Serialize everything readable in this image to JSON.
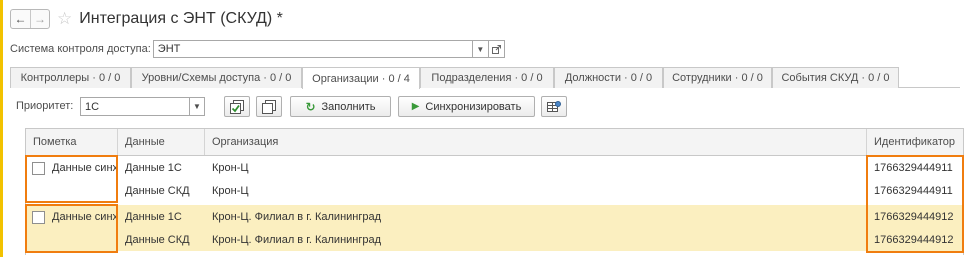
{
  "header": {
    "back_icon": "←",
    "forward_icon": "→",
    "star_icon": "☆",
    "title": "Интеграция с ЭНТ (СКУД) *"
  },
  "access_system": {
    "label": "Система контроля доступа:",
    "value": "ЭНТ"
  },
  "tabs": [
    {
      "label": "Контроллеры · 0 / 0"
    },
    {
      "label": "Уровни/Схемы доступа · 0 / 0"
    },
    {
      "label": "Организации · 0 / 4"
    },
    {
      "label": "Подразделения · 0 / 0"
    },
    {
      "label": "Должности · 0 / 0"
    },
    {
      "label": "Сотрудники · 0 / 0"
    },
    {
      "label": "События СКУД · 0 / 0"
    }
  ],
  "active_tab_index": 2,
  "toolbar": {
    "priority_label": "Приоритет:",
    "priority_value": "1С",
    "fill_label": "Заполнить",
    "sync_label": "Синхронизировать"
  },
  "table": {
    "columns": [
      "Пометка",
      "Данные",
      "Организация",
      "Идентификатор"
    ],
    "groups": [
      {
        "mark_label": "Данные синхронизи",
        "checked": false,
        "selected": false
      },
      {
        "mark_label": "Данные синхронизи",
        "checked": false,
        "selected": true
      }
    ],
    "rows": [
      {
        "data": "Данные 1С",
        "org": "Крон-Ц",
        "id": "1766329444911"
      },
      {
        "data": "Данные СКД",
        "org": "Крон-Ц",
        "id": "1766329444911"
      },
      {
        "data": "Данные 1С",
        "org": "Крон-Ц. Филиал в г. Калининград",
        "id": "1766329444912"
      },
      {
        "data": "Данные СКД",
        "org": "Крон-Ц. Филиал в г. Калининград",
        "id": "1766329444912"
      }
    ]
  },
  "colors": {
    "highlight": "#f07d0f",
    "selected_row": "#fbefc0",
    "accent_bar": "#f2c200"
  }
}
